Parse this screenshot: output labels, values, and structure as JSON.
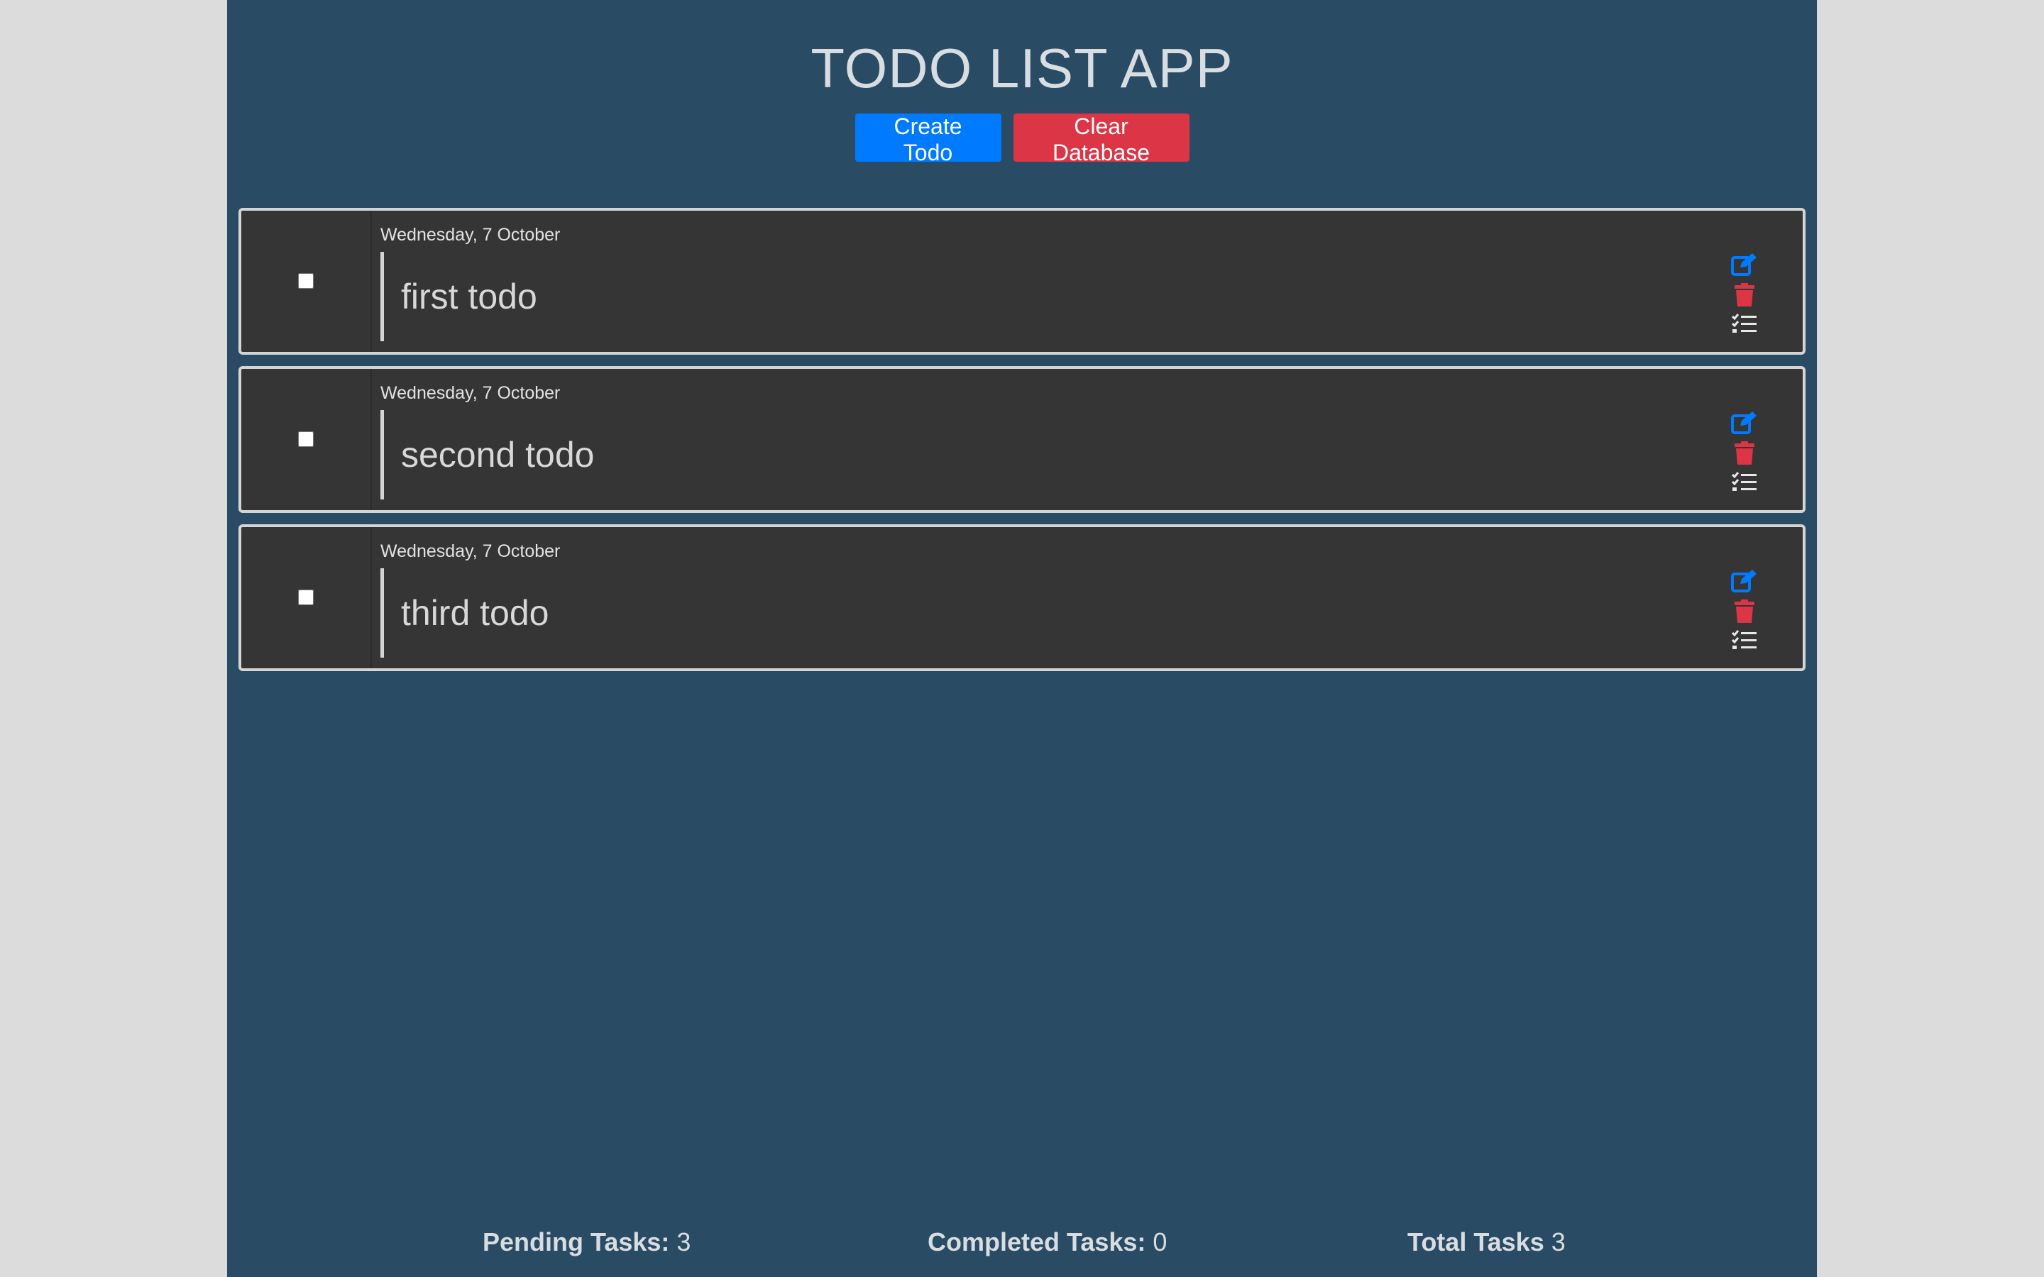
{
  "header": {
    "title": "TODO LIST APP",
    "create_button": "Create Todo",
    "clear_button": "Clear Database"
  },
  "todos": [
    {
      "date": "Wednesday, 7 October",
      "text": "first todo",
      "completed": false
    },
    {
      "date": "Wednesday, 7 October",
      "text": "second todo",
      "completed": false
    },
    {
      "date": "Wednesday, 7 October",
      "text": "third todo",
      "completed": false
    }
  ],
  "icons": {
    "edit": "edit-icon",
    "delete": "trash-icon",
    "details": "checklist-icon"
  },
  "footer": {
    "pending_label": "Pending Tasks:",
    "pending_value": "3",
    "completed_label": "Completed Tasks:",
    "completed_value": "0",
    "total_label": "Total Tasks",
    "total_value": "3"
  },
  "colors": {
    "background": "#294b64",
    "card": "#353535",
    "primary": "#007bff",
    "danger": "#dc3545"
  }
}
